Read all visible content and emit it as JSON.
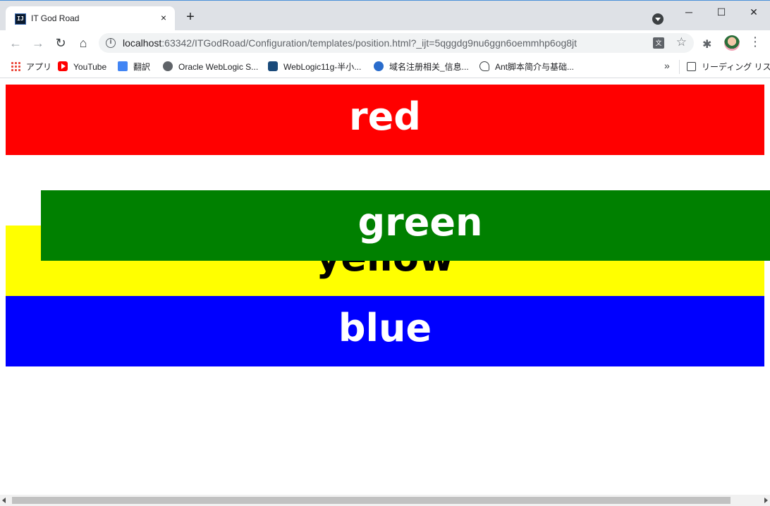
{
  "browser": {
    "tab_title": "IT God Road",
    "tab_favicon_text": "IJ",
    "tab_close": "×",
    "new_tab": "+",
    "window_controls": {
      "minimize": "─",
      "maximize": "☐",
      "close": "✕"
    },
    "nav": {
      "back": "←",
      "forward": "→",
      "reload": "↻",
      "home": "⌂"
    },
    "url_host": "localhost",
    "url_rest": ":63342/ITGodRoad/Configuration/templates/position.html?_ijt=5qggdg9nu6ggn6oemmhp6og8jt",
    "info_icon": "i",
    "star": "☆",
    "extensions": "✱",
    "menu": "⋮",
    "bookmarks": [
      {
        "label": "アプリ",
        "icon": "apps-grid-icon"
      },
      {
        "label": "YouTube",
        "icon": "youtube-icon"
      },
      {
        "label": "翻訳",
        "icon": "google-translate-icon"
      },
      {
        "label": "Oracle WebLogic S...",
        "icon": "globe-icon"
      },
      {
        "label": "WebLogic11g-半小...",
        "icon": "weblogic-icon"
      },
      {
        "label": "域名注册相关_信息...",
        "icon": "vs-icon"
      },
      {
        "label": "Ant脚本简介与基础...",
        "icon": "ant-icon"
      }
    ],
    "bookmarks_more": "»",
    "reading_list": "リーディング リスト"
  },
  "page": {
    "boxes": {
      "red": "red",
      "yellow": "yellow",
      "green": "green",
      "blue": "blue"
    },
    "colors": {
      "red": "#ff0000",
      "yellow": "#ffff00",
      "green": "#008000",
      "blue": "#0000ff"
    }
  }
}
